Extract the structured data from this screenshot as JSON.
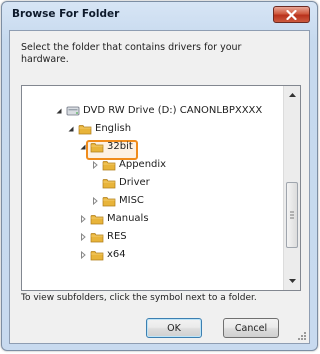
{
  "window": {
    "title": "Browse For Folder",
    "close_icon": "close-icon"
  },
  "dialog": {
    "instruction": "Select the folder that contains drivers for your\nhardware.",
    "hint": "To view subfolders, click the symbol next to a folder.",
    "ok_label": "OK",
    "cancel_label": "Cancel"
  },
  "tree": {
    "items": [
      {
        "label": "DVD RW Drive (D:) CANONLBPXXXX",
        "level": 0,
        "expander": "expanded",
        "icon": "dvd-drive-icon"
      },
      {
        "label": "English",
        "level": 1,
        "expander": "expanded",
        "icon": "folder-icon"
      },
      {
        "label": "32bit",
        "level": 2,
        "expander": "expanded",
        "icon": "folder-icon"
      },
      {
        "label": "Appendix",
        "level": 3,
        "expander": "collapsed",
        "icon": "folder-icon"
      },
      {
        "label": "Driver",
        "level": 3,
        "expander": "none",
        "icon": "folder-icon",
        "selected": true
      },
      {
        "label": "MISC",
        "level": 3,
        "expander": "collapsed",
        "icon": "folder-icon"
      },
      {
        "label": "Manuals",
        "level": 2,
        "expander": "collapsed",
        "icon": "folder-icon"
      },
      {
        "label": "RES",
        "level": 2,
        "expander": "collapsed",
        "icon": "folder-icon"
      },
      {
        "label": "x64",
        "level": 2,
        "expander": "collapsed",
        "icon": "folder-icon"
      }
    ]
  },
  "colors": {
    "selection_highlight": "#f08c1c",
    "folder": "#e8b43a"
  }
}
